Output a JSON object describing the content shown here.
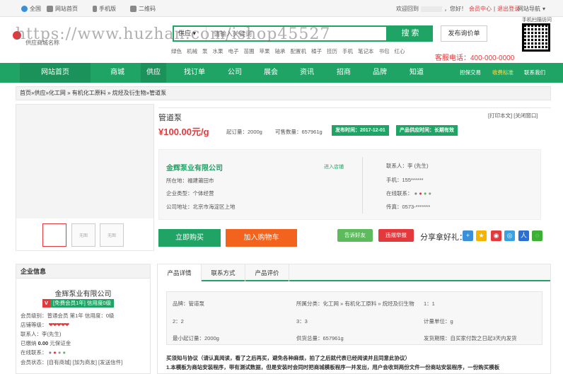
{
  "topbar": {
    "left": [
      "全国",
      "网站首页",
      "手机版",
      "二维码"
    ],
    "welcome": "欢迎回到",
    "user_suffix": "，您好！",
    "member_center": "会员中心",
    "logout": "退出登录",
    "site_nav": "网站导航"
  },
  "header": {
    "logo_text": "供应商城名称",
    "search_category": "供应",
    "search_placeholder": "请输入关键词",
    "search_button": "搜 索",
    "publish_button": "发布询价单",
    "hotwords": [
      "绿色",
      "机械",
      "泵",
      "水果",
      "电子",
      "苗圃",
      "苹果",
      "轴承",
      "配置机",
      "橘子",
      "挂历",
      "手机",
      "笔记本",
      "书包",
      "红心"
    ],
    "hotline_label": "客服电话：",
    "hotline_number": "400-000-0000",
    "qr_label": "手机扫描访问"
  },
  "watermark": "https://www.huzhan.com/ishop45527",
  "nav": {
    "items": [
      "网站首页",
      "商城",
      "供应",
      "找订单",
      "公司",
      "展会",
      "资讯",
      "招商",
      "品牌",
      "知道"
    ],
    "right": [
      "担保交易",
      "收费标准",
      "联系我们"
    ]
  },
  "breadcrumb": "首页»供应»化工网 » 有机化工原料 » 烷烃及衍生物»管道泵",
  "product": {
    "title": "管道泵",
    "price": "¥100.00元/g",
    "moq": "起订量：2000g",
    "stock": "可售数量：657961g",
    "publish_tag": "发布时间：2017-12-01",
    "valid_tag": "产品供应时间：长期有效",
    "print_links": "[打印本文] [关闭窗口]",
    "thumb_label": "无图"
  },
  "company": {
    "name": "金辉泵业有限公司",
    "enter_store": "进入店铺",
    "location": "所在地：福建莆田市",
    "type": "企业类型：个体经营",
    "address": "公司地址：北京市海淀区上地",
    "contact": "联系人：李 (先生)",
    "mobile": "手机：155******",
    "online": "在线联系：",
    "fax": "传真：0573-*******"
  },
  "actions": {
    "buy": "立即购买",
    "cart": "加入购物车",
    "tell": "告诉好友",
    "report": "违规举报",
    "share": "分享拿好礼："
  },
  "sidebar": {
    "title": "企业信息",
    "company": "金辉泵业有限公司",
    "badge_v": "V",
    "badge_text": "[免费会员1年] 信用度0级",
    "level": "会员级别：普通会员 第1年 信用度：0级",
    "grade_label": "店铺等级：",
    "contact": "联系人：李(先生)",
    "deposit_label": "已缴纳",
    "deposit_value": "0.00",
    "deposit_suffix": "元保证金",
    "online": "在线联系：",
    "status": "会员状态：[自有商城] [加为商友] [发送信件]"
  },
  "detail": {
    "tabs": [
      "产品详情",
      "联系方式",
      "产品评价"
    ],
    "attrs": {
      "brand": "品牌：管道泵",
      "category": "所属分类：化工网 » 有机化工原料 » 烷烃及衍生物",
      "one": "1：1",
      "two": "2：2",
      "three": "3：3",
      "unit": "计量单位：g",
      "moq": "最小起订量：2000g",
      "supply": "供货总量：657961g",
      "delivery": "发货期限：自买家付款之日起3天内发货"
    },
    "notice_title": "买须知与协议（请认真阅读，看了之后再买，避免各种麻烦，拍了之后就代表已经阅读并且同意此协议）",
    "notice_1": "1.本模板为商站安装程序，带有测试数据，但是安装时会同时把商城模板程序一并发出，用户会收到两份文件一份商站安装程序，一份购买模板"
  }
}
